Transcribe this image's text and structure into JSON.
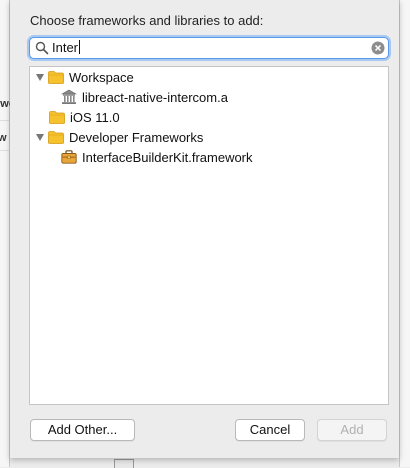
{
  "background": {
    "left_fragments": [
      "rwo",
      "w"
    ]
  },
  "dialog": {
    "prompt": "Choose frameworks and libraries to add:",
    "search": {
      "value": "Inter",
      "accent": "#5b9be8"
    },
    "tree": [
      {
        "label": "Workspace",
        "icon": "folder-icon",
        "expanded": true
      },
      {
        "label": "libreact-native-intercom.a",
        "icon": "library-icon"
      },
      {
        "label": "iOS 11.0",
        "icon": "folder-icon"
      },
      {
        "label": "Developer Frameworks",
        "icon": "folder-icon",
        "expanded": true
      },
      {
        "label": "InterfaceBuilderKit.framework",
        "icon": "framework-toolbox-icon"
      }
    ],
    "buttons": {
      "add_other": "Add Other...",
      "cancel": "Cancel",
      "add": "Add",
      "add_enabled": false
    }
  }
}
